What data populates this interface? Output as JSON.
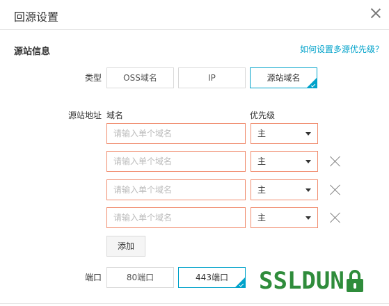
{
  "dialog": {
    "title": "回源设置"
  },
  "section": {
    "title": "源站信息",
    "help_link": "如何设置多源优先级？"
  },
  "type_field": {
    "label": "类型",
    "options": [
      {
        "label": "OSS域名",
        "selected": false
      },
      {
        "label": "IP",
        "selected": false
      },
      {
        "label": "源站域名",
        "selected": true
      }
    ]
  },
  "origin_field": {
    "label": "源站地址",
    "col_domain": "域名",
    "col_priority": "优先级",
    "rows": [
      {
        "placeholder": "请输入单个域名",
        "priority": "主",
        "removable": false
      },
      {
        "placeholder": "请输入单个域名",
        "priority": "主",
        "removable": true
      },
      {
        "placeholder": "请输入单个域名",
        "priority": "主",
        "removable": true
      },
      {
        "placeholder": "请输入单个域名",
        "priority": "主",
        "removable": true
      }
    ],
    "add_label": "添加"
  },
  "port_field": {
    "label": "端口",
    "options": [
      {
        "label": "80端口",
        "selected": false
      },
      {
        "label": "443端口",
        "selected": true
      }
    ]
  },
  "watermark": {
    "part1": "SSL",
    "part2": "DUN"
  },
  "colors": {
    "accent": "#00a2ca",
    "error_border": "#f08a6c",
    "watermark_green": "#2f8c3b"
  }
}
